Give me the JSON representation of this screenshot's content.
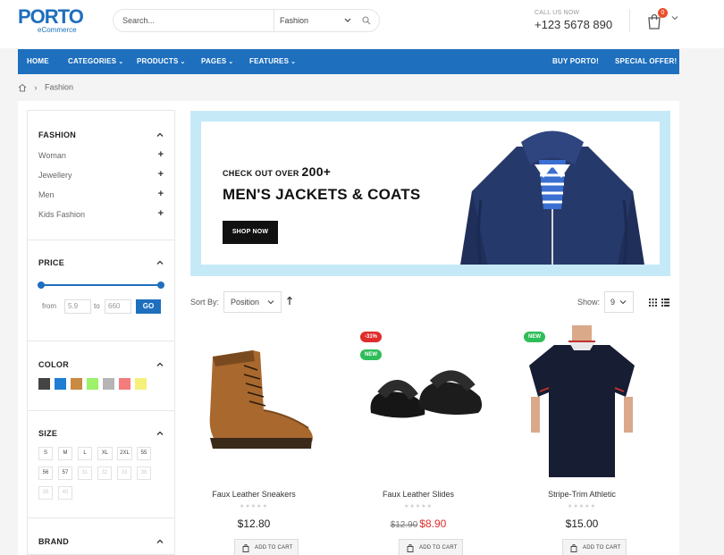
{
  "header": {
    "logo_main": "PORTO",
    "logo_sub": "eCommerce",
    "search_placeholder": "Search...",
    "search_category": "Fashion",
    "call_label": "CALL US NOW",
    "phone": "+123 5678 890",
    "cart_count": "0"
  },
  "nav": {
    "items": [
      {
        "label": "HOME"
      },
      {
        "label": "CATEGORIES"
      },
      {
        "label": "PRODUCTS"
      },
      {
        "label": "PAGES"
      },
      {
        "label": "FEATURES"
      }
    ],
    "right_items": [
      {
        "label": "BUY PORTO!"
      },
      {
        "label": "SPECIAL OFFER!"
      }
    ],
    "color": "#1e6fbe"
  },
  "breadcrumb": {
    "separator": "›",
    "current": "Fashion"
  },
  "sidebar": {
    "fashion": {
      "title": "FASHION",
      "items": [
        "Woman",
        "Jewellery",
        "Men",
        "Kids Fashion"
      ]
    },
    "price": {
      "title": "PRICE",
      "from_label": "from",
      "to_label": "to",
      "from_value": "5.9",
      "to_value": "660",
      "go_label": "GO"
    },
    "color": {
      "title": "COLOR",
      "swatches": [
        "#444444",
        "#1e7ed4",
        "#c98a43",
        "#9cf26a",
        "#b5b5b5",
        "#f47c7c",
        "#f4f07a"
      ]
    },
    "size": {
      "title": "SIZE",
      "sizes": [
        "S",
        "M",
        "L",
        "XL",
        "2XL",
        "55",
        "56",
        "57",
        "31",
        "32",
        "33",
        "38",
        "39",
        "40"
      ]
    },
    "brand": {
      "title": "BRAND"
    }
  },
  "banner": {
    "kicker": "CHECK OUT OVER",
    "kicker_number": "200+",
    "title": "MEN'S JACKETS & COATS",
    "button": "SHOP NOW"
  },
  "toolbar": {
    "sort_label": "Sort By:",
    "sort_value": "Position",
    "show_label": "Show:",
    "show_value": "9"
  },
  "products": [
    {
      "name": "Faux Leather Sneakers",
      "price": "$12.80",
      "old_price": "",
      "badges": [],
      "cart_label": "ADD TO CART"
    },
    {
      "name": "Faux Leather Slides",
      "price": "$8.90",
      "old_price": "$12.90",
      "badges": [
        {
          "text": "-31%",
          "color": "#e02c2c"
        },
        {
          "text": "NEW",
          "color": "#2ebd59"
        }
      ],
      "cart_label": "ADD TO CART"
    },
    {
      "name": "Stripe-Trim Athletic",
      "price": "$15.00",
      "old_price": "",
      "badges": [
        {
          "text": "NEW",
          "color": "#2ebd59"
        }
      ],
      "cart_label": "ADD TO CART"
    }
  ]
}
